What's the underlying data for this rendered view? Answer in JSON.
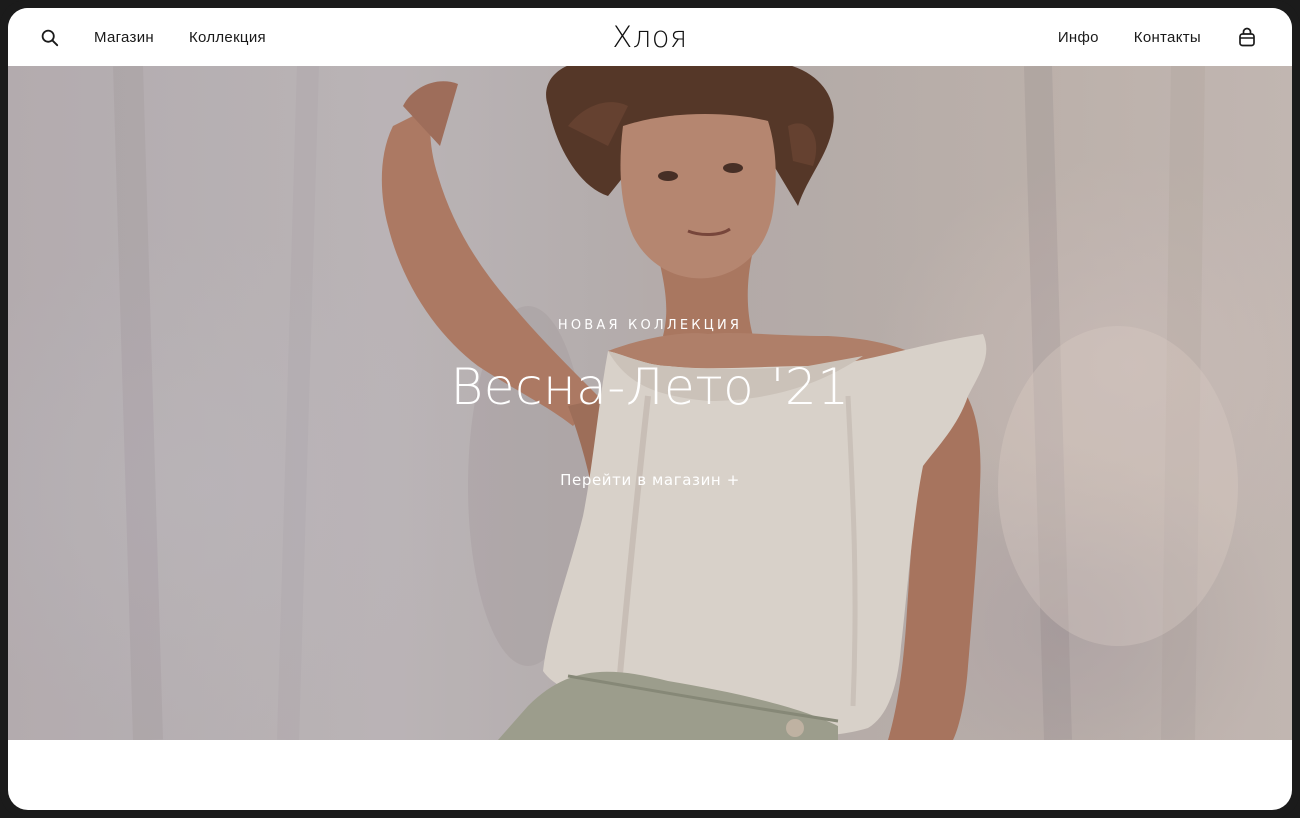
{
  "header": {
    "logo": "Хлоя",
    "left_nav": [
      {
        "label": "Магазин"
      },
      {
        "label": "Коллекция"
      }
    ],
    "right_nav": [
      {
        "label": "Инфо"
      },
      {
        "label": "Контакты"
      }
    ],
    "icons": {
      "search": "search-icon",
      "bag": "shopping-bag-icon"
    }
  },
  "hero": {
    "eyebrow": "НОВАЯ КОЛЛЕКЦИЯ",
    "title": "Весна-Лето '21",
    "cta": "Перейти в магазин +"
  },
  "colors": {
    "text_dark": "#1a1a1a",
    "hero_text": "#ffffff",
    "frame": "#1b1b1b"
  }
}
